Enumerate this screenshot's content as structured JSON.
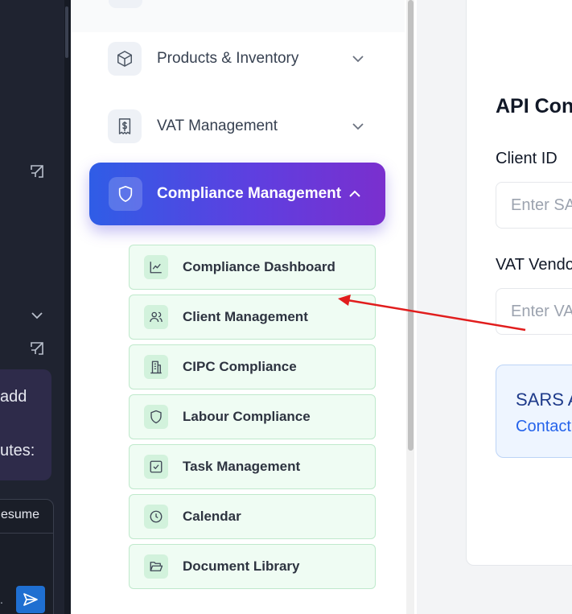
{
  "chat": {
    "bubble_line1": "add",
    "bubble_line2": "utes:",
    "resume_label": "esume",
    "dot": "."
  },
  "sidebar": {
    "nav_items": [
      {
        "label": "Products & Inventory",
        "icon": "cube-icon"
      },
      {
        "label": "VAT Management",
        "icon": "receipt-icon"
      }
    ],
    "active_item": {
      "label": "Compliance Management",
      "icon": "shield-icon"
    },
    "sub_items": [
      {
        "label": "Compliance Dashboard",
        "icon": "chart-line-icon"
      },
      {
        "label": "Client Management",
        "icon": "users-icon"
      },
      {
        "label": "CIPC Compliance",
        "icon": "building-icon"
      },
      {
        "label": "Labour Compliance",
        "icon": "shield-icon"
      },
      {
        "label": "Task Management",
        "icon": "check-square-icon"
      },
      {
        "label": "Calendar",
        "icon": "clock-icon"
      },
      {
        "label": "Document Library",
        "icon": "folder-open-icon"
      }
    ]
  },
  "content": {
    "title": "API Con",
    "client_id_label": "Client ID",
    "client_id_placeholder": "Enter SAR",
    "vat_vendor_label": "VAT Vendo",
    "vat_vendor_placeholder": "Enter VA",
    "sars_title": "SARS A",
    "sars_contact": "Contact"
  },
  "colors": {
    "accent_gradient_start": "#2f5de6",
    "accent_gradient_end": "#7a2fce",
    "submenu_bg": "#effcf3",
    "annotation_arrow": "#e11d1d"
  }
}
